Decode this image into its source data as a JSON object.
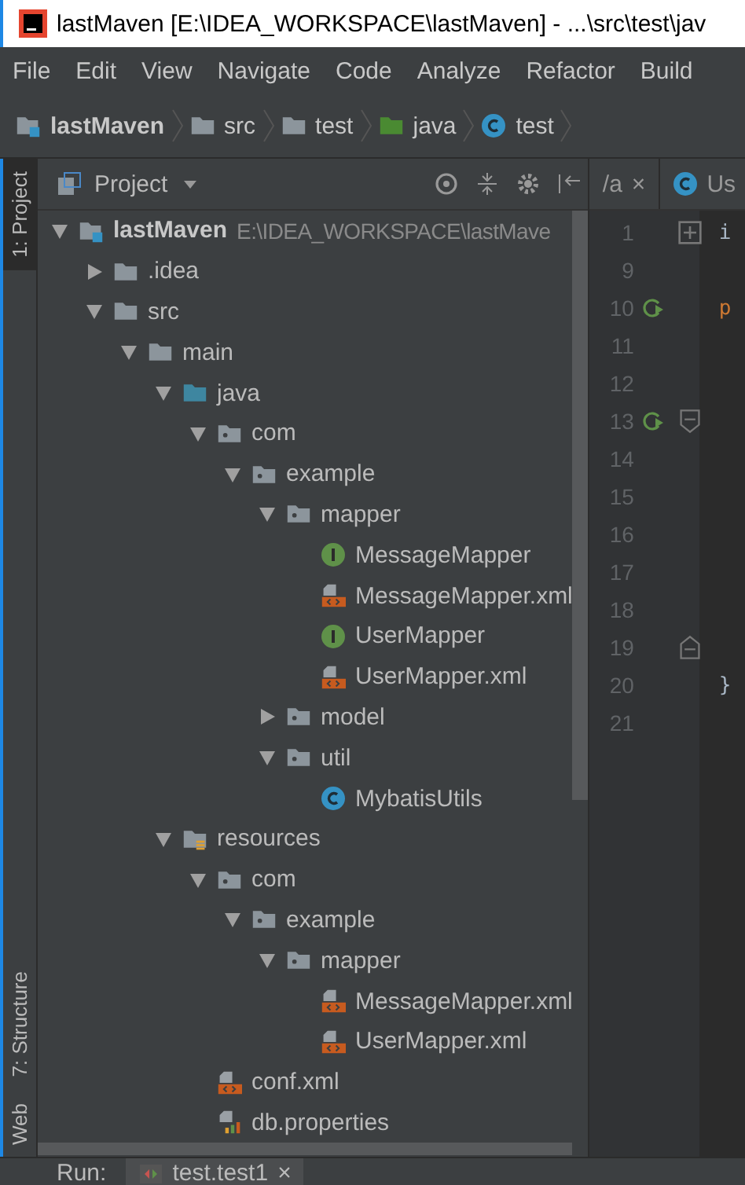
{
  "window": {
    "title": "lastMaven [E:\\IDEA_WORKSPACE\\lastMaven] - ...\\src\\test\\jav"
  },
  "menu": [
    "File",
    "Edit",
    "View",
    "Navigate",
    "Code",
    "Analyze",
    "Refactor",
    "Build"
  ],
  "breadcrumbs": [
    {
      "label": "lastMaven",
      "kind": "module"
    },
    {
      "label": "src",
      "kind": "folder"
    },
    {
      "label": "test",
      "kind": "folder"
    },
    {
      "label": "java",
      "kind": "test_root"
    },
    {
      "label": "test",
      "kind": "class"
    }
  ],
  "side_tabs": [
    {
      "label": "1: Project",
      "selected": true
    },
    {
      "label": "7: Structure",
      "selected": false
    },
    {
      "label": "Web",
      "selected": false
    }
  ],
  "project_panel": {
    "title": "Project"
  },
  "editor_tabs": [
    {
      "label": "/a",
      "close": "×",
      "kind": "plain"
    },
    {
      "label": "Us",
      "kind": "class"
    }
  ],
  "tree": [
    {
      "label": "lastMaven",
      "path": "E:\\IDEA_WORKSPACE\\lastMave",
      "kind": "module",
      "expanded": true,
      "children": [
        {
          "label": ".idea",
          "kind": "folder",
          "expanded": false
        },
        {
          "label": "src",
          "kind": "folder",
          "expanded": true,
          "children": [
            {
              "label": "main",
              "kind": "folder",
              "expanded": true,
              "children": [
                {
                  "label": "java",
                  "kind": "source_root",
                  "expanded": true,
                  "children": [
                    {
                      "label": "com",
                      "kind": "package",
                      "expanded": true,
                      "children": [
                        {
                          "label": "example",
                          "kind": "package",
                          "expanded": true,
                          "children": [
                            {
                              "label": "mapper",
                              "kind": "package",
                              "expanded": true,
                              "children": [
                                {
                                  "label": "MessageMapper",
                                  "kind": "interface"
                                },
                                {
                                  "label": "MessageMapper.xml",
                                  "kind": "xml"
                                },
                                {
                                  "label": "UserMapper",
                                  "kind": "interface"
                                },
                                {
                                  "label": "UserMapper.xml",
                                  "kind": "xml"
                                }
                              ]
                            },
                            {
                              "label": "model",
                              "kind": "package",
                              "expanded": false
                            },
                            {
                              "label": "util",
                              "kind": "package",
                              "expanded": true,
                              "children": [
                                {
                                  "label": "MybatisUtils",
                                  "kind": "class"
                                }
                              ]
                            }
                          ]
                        }
                      ]
                    }
                  ]
                },
                {
                  "label": "resources",
                  "kind": "resources",
                  "expanded": true,
                  "children": [
                    {
                      "label": "com",
                      "kind": "package",
                      "expanded": true,
                      "children": [
                        {
                          "label": "example",
                          "kind": "package",
                          "expanded": true,
                          "children": [
                            {
                              "label": "mapper",
                              "kind": "package",
                              "expanded": true,
                              "children": [
                                {
                                  "label": "MessageMapper.xml",
                                  "kind": "xml"
                                },
                                {
                                  "label": "UserMapper.xml",
                                  "kind": "xml"
                                }
                              ]
                            }
                          ]
                        }
                      ]
                    },
                    {
                      "label": "conf.xml",
                      "kind": "xml"
                    },
                    {
                      "label": "db.properties",
                      "kind": "properties"
                    }
                  ]
                }
              ]
            }
          ]
        }
      ]
    }
  ],
  "gutter": [
    {
      "line": "1",
      "folded": true,
      "code": "i"
    },
    {
      "line": "9"
    },
    {
      "line": "10",
      "runnable": true,
      "code": "p"
    },
    {
      "line": "11"
    },
    {
      "line": "12"
    },
    {
      "line": "13",
      "runnable": true,
      "fold_start": true
    },
    {
      "line": "14"
    },
    {
      "line": "15"
    },
    {
      "line": "16"
    },
    {
      "line": "17"
    },
    {
      "line": "18"
    },
    {
      "line": "19",
      "fold_end": true
    },
    {
      "line": "20",
      "code": "}"
    },
    {
      "line": "21"
    }
  ],
  "run_bar": {
    "label": "Run:",
    "tab": "test.test1",
    "close": "×"
  }
}
